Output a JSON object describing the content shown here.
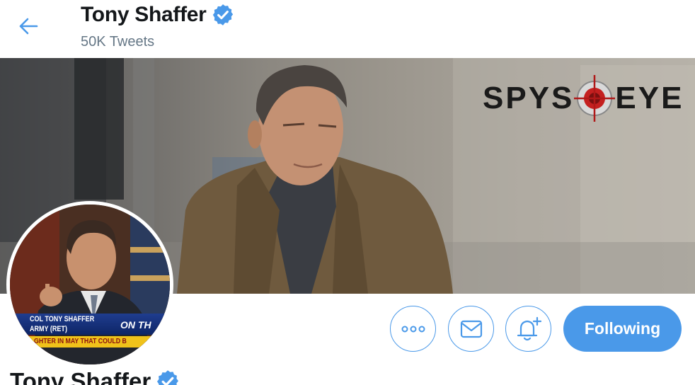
{
  "header": {
    "back_icon": "arrow-left-icon",
    "name": "Tony Shaffer",
    "verified_icon": "verified-badge-icon",
    "tweet_count": "50K Tweets"
  },
  "banner": {
    "logo_left": "SPYS",
    "logo_right": "EYE",
    "logo_icon": "crosshair-icon"
  },
  "avatar": {
    "ticker_line1": "COL TONY SHAFFER",
    "ticker_line2": "ARMY (RET)",
    "ticker_tag": "ON TH",
    "ticker_line3": "GHTER IN MAY THAT COULD B"
  },
  "actions": {
    "more_icon": "more-dots-icon",
    "message_icon": "envelope-icon",
    "notify_icon": "bell-plus-icon",
    "follow_label": "Following"
  },
  "profile": {
    "name": "Tony Shaffer",
    "verified_icon": "verified-badge-icon"
  },
  "colors": {
    "accent": "#4a99e9",
    "text": "#14171a",
    "muted": "#657786"
  }
}
